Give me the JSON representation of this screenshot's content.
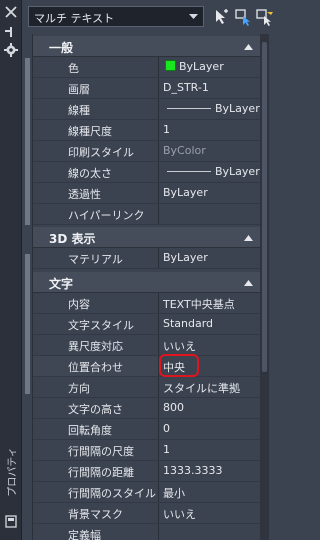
{
  "palette": {
    "title": "プロパティ"
  },
  "header": {
    "selection": "マルチ テキスト"
  },
  "categories": {
    "general": "一般",
    "view3d": "3D 表示",
    "text": "文字"
  },
  "general": [
    {
      "label": "色",
      "value": "ByLayer"
    },
    {
      "label": "画層",
      "value": "D_STR-1"
    },
    {
      "label": "線種",
      "value": "ByLayer"
    },
    {
      "label": "線種尺度",
      "value": "1"
    },
    {
      "label": "印刷スタイル",
      "value": "ByColor"
    },
    {
      "label": "線の太さ",
      "value": "ByLayer"
    },
    {
      "label": "透過性",
      "value": "ByLayer"
    },
    {
      "label": "ハイパーリンク",
      "value": ""
    }
  ],
  "view3d": [
    {
      "label": "マテリアル",
      "value": "ByLayer"
    }
  ],
  "text": [
    {
      "label": "内容",
      "value": "TEXT中央基点"
    },
    {
      "label": "文字スタイル",
      "value": "Standard"
    },
    {
      "label": "異尺度対応",
      "value": "いいえ"
    },
    {
      "label": "位置合わせ",
      "value": "中央"
    },
    {
      "label": "方向",
      "value": "スタイルに準拠"
    },
    {
      "label": "文字の高さ",
      "value": "800"
    },
    {
      "label": "回転角度",
      "value": "0"
    },
    {
      "label": "行間隔の尺度",
      "value": "1"
    },
    {
      "label": "行間隔の距離",
      "value": "1333.3333"
    },
    {
      "label": "行間隔のスタイル",
      "value": "最小"
    },
    {
      "label": "背景マスク",
      "value": "いいえ"
    },
    {
      "label": "定義幅",
      "value": ""
    }
  ],
  "colors": {
    "swatch": "#19e61e",
    "highlight": "#e0141e"
  }
}
